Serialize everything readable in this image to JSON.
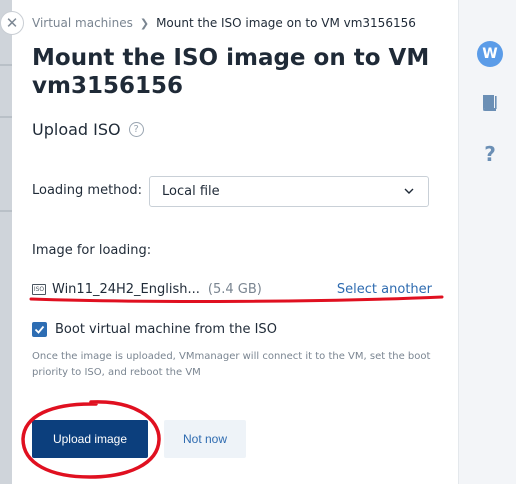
{
  "breadcrumb": {
    "parent": "Virtual machines",
    "current": "Mount the ISO image on to VM vm3156156"
  },
  "title": "Mount the ISO image on to VM vm3156156",
  "section_title": "Upload ISO",
  "loading_method": {
    "label": "Loading method:",
    "value": "Local file"
  },
  "image": {
    "label": "Image for loading:",
    "file_name": "Win11_24H2_English...",
    "file_size": "(5.4 GB)",
    "select_another": "Select another"
  },
  "boot": {
    "checked": true,
    "label": "Boot virtual machine from the ISO",
    "hint": "Once the image is uploaded, VMmanager will connect it to the VM, set the boot priority to ISO, and reboot the VM"
  },
  "buttons": {
    "upload": "Upload image",
    "not_now": "Not now"
  },
  "rail": {
    "avatar_letter": "W"
  },
  "colors": {
    "primary": "#0c3f7d",
    "link": "#2e6bb0",
    "checkbox": "#2d6db3",
    "annotation": "#e01020",
    "avatar": "#5b9ce8"
  }
}
